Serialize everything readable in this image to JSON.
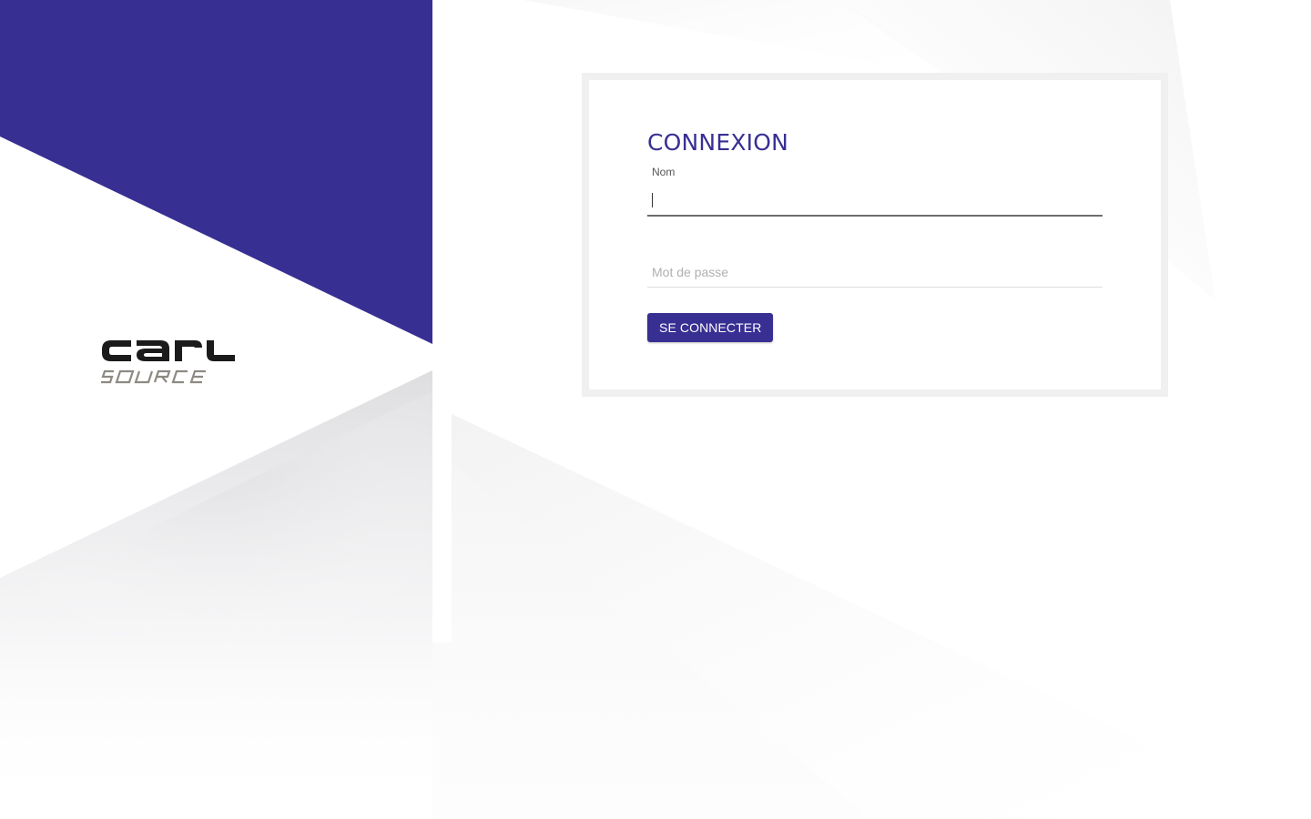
{
  "brand": {
    "name": "carl source",
    "logo_icon": "carl-source-logo",
    "accent_color": "#382f93"
  },
  "login": {
    "title": "CONNEXION",
    "username": {
      "label": "Nom",
      "value": ""
    },
    "password": {
      "placeholder": "Mot de passe",
      "value": ""
    },
    "submit_label": "SE CONNECTER"
  }
}
